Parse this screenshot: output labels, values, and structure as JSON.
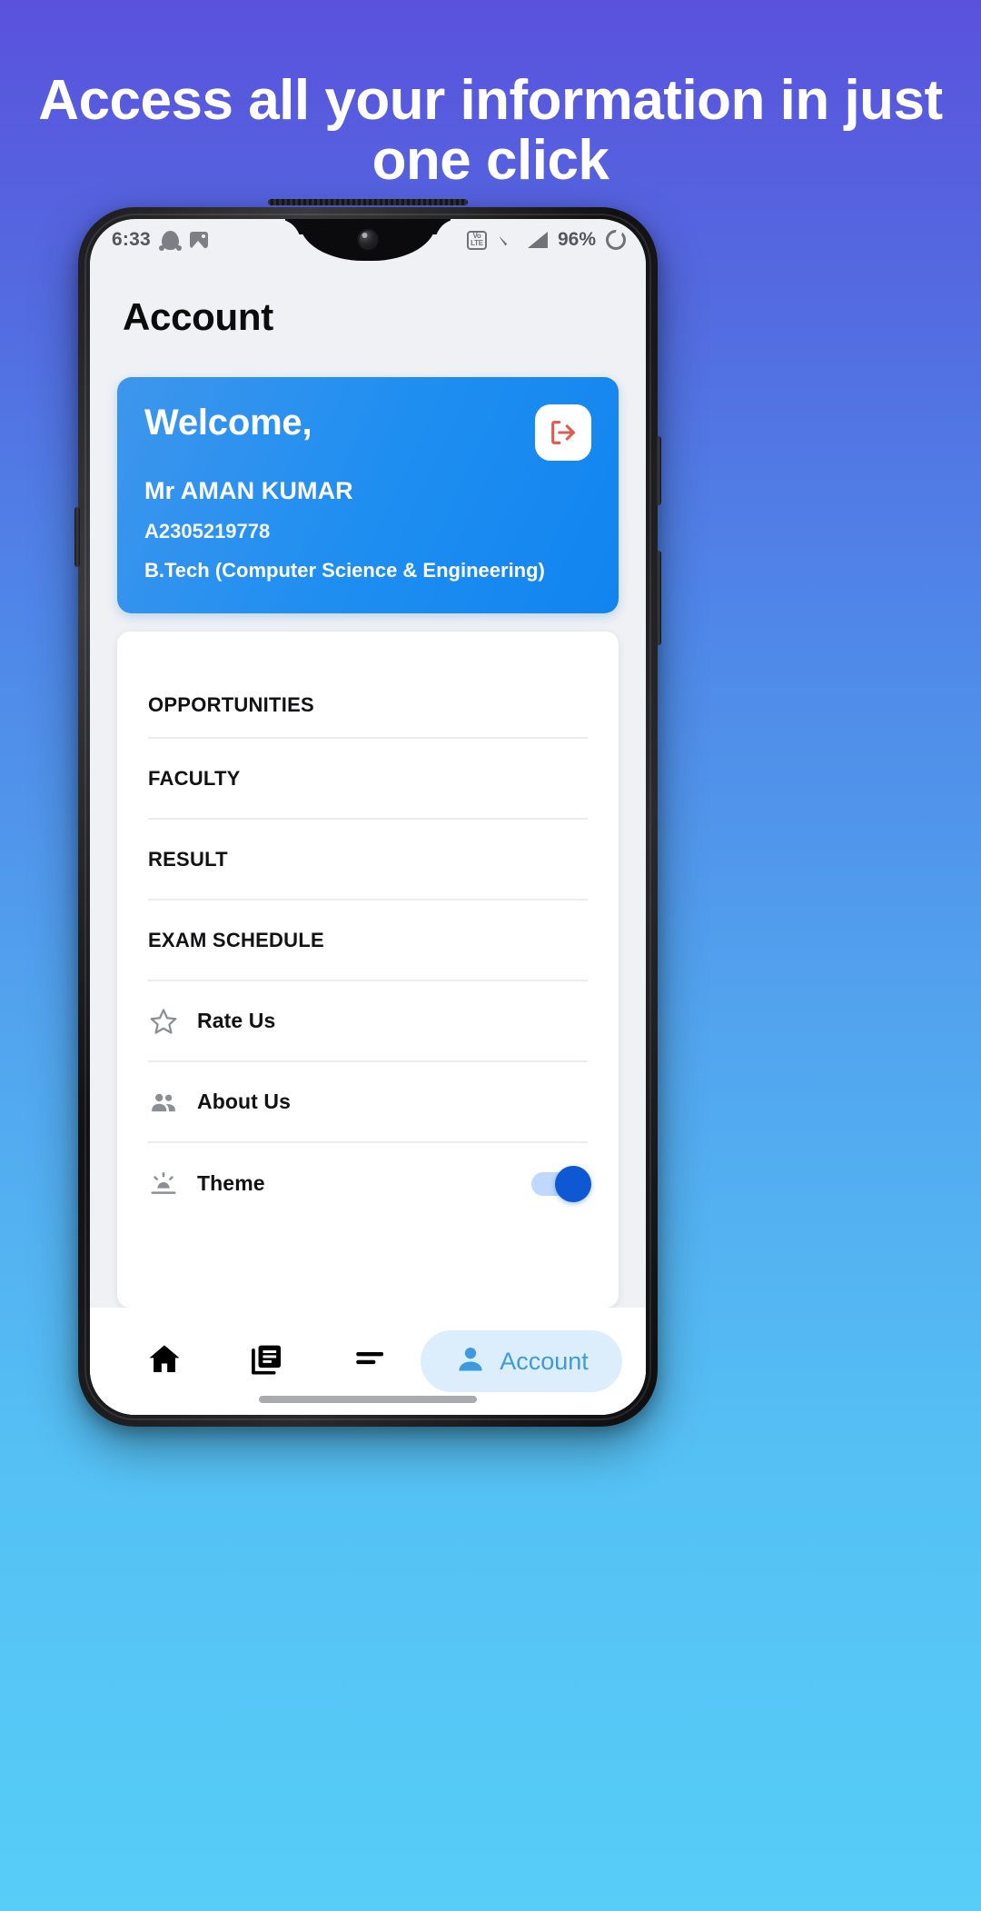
{
  "promo": {
    "headline": "Access all your information in just one click",
    "background_top": "#5a52dd",
    "background_bottom": "#57cdf8"
  },
  "status_bar": {
    "time": "6:33",
    "icons_left": [
      "snapchat-icon",
      "image-icon"
    ],
    "volte_top": "Vo",
    "volte_bottom": "LTE",
    "battery_percent": "96%",
    "icons_right": [
      "volte-icon",
      "wifi-icon",
      "signal-icon",
      "battery-icon"
    ]
  },
  "app": {
    "page_title": "Account",
    "accent_blue": "#1e8ef1",
    "logout_icon_color": "#e15a52"
  },
  "welcome_card": {
    "greeting": "Welcome,",
    "user_name": "Mr AMAN KUMAR",
    "enrollment_id": "A2305219778",
    "course": "B.Tech (Computer Science & Engineering)",
    "logout_icon": "logout-icon"
  },
  "menu": {
    "items": [
      {
        "label": "OPPORTUNITIES",
        "icon": null,
        "type": "link"
      },
      {
        "label": "FACULTY",
        "icon": null,
        "type": "link"
      },
      {
        "label": "RESULT",
        "icon": null,
        "type": "link"
      },
      {
        "label": "EXAM SCHEDULE",
        "icon": null,
        "type": "link"
      },
      {
        "label": "Rate Us",
        "icon": "star-icon",
        "type": "link"
      },
      {
        "label": "About Us",
        "icon": "people-icon",
        "type": "link"
      },
      {
        "label": "Theme",
        "icon": "brightness-icon",
        "type": "toggle",
        "toggle_on": true
      }
    ]
  },
  "bottom_nav": {
    "items": [
      {
        "label": "",
        "icon": "home-icon",
        "active": false
      },
      {
        "label": "",
        "icon": "library-books-icon",
        "active": false
      },
      {
        "label": "",
        "icon": "short-text-icon",
        "active": false
      },
      {
        "label": "Account",
        "icon": "person-icon",
        "active": true
      }
    ],
    "active_pill_color": "#dceefb",
    "active_text_color": "#3d9ade"
  }
}
